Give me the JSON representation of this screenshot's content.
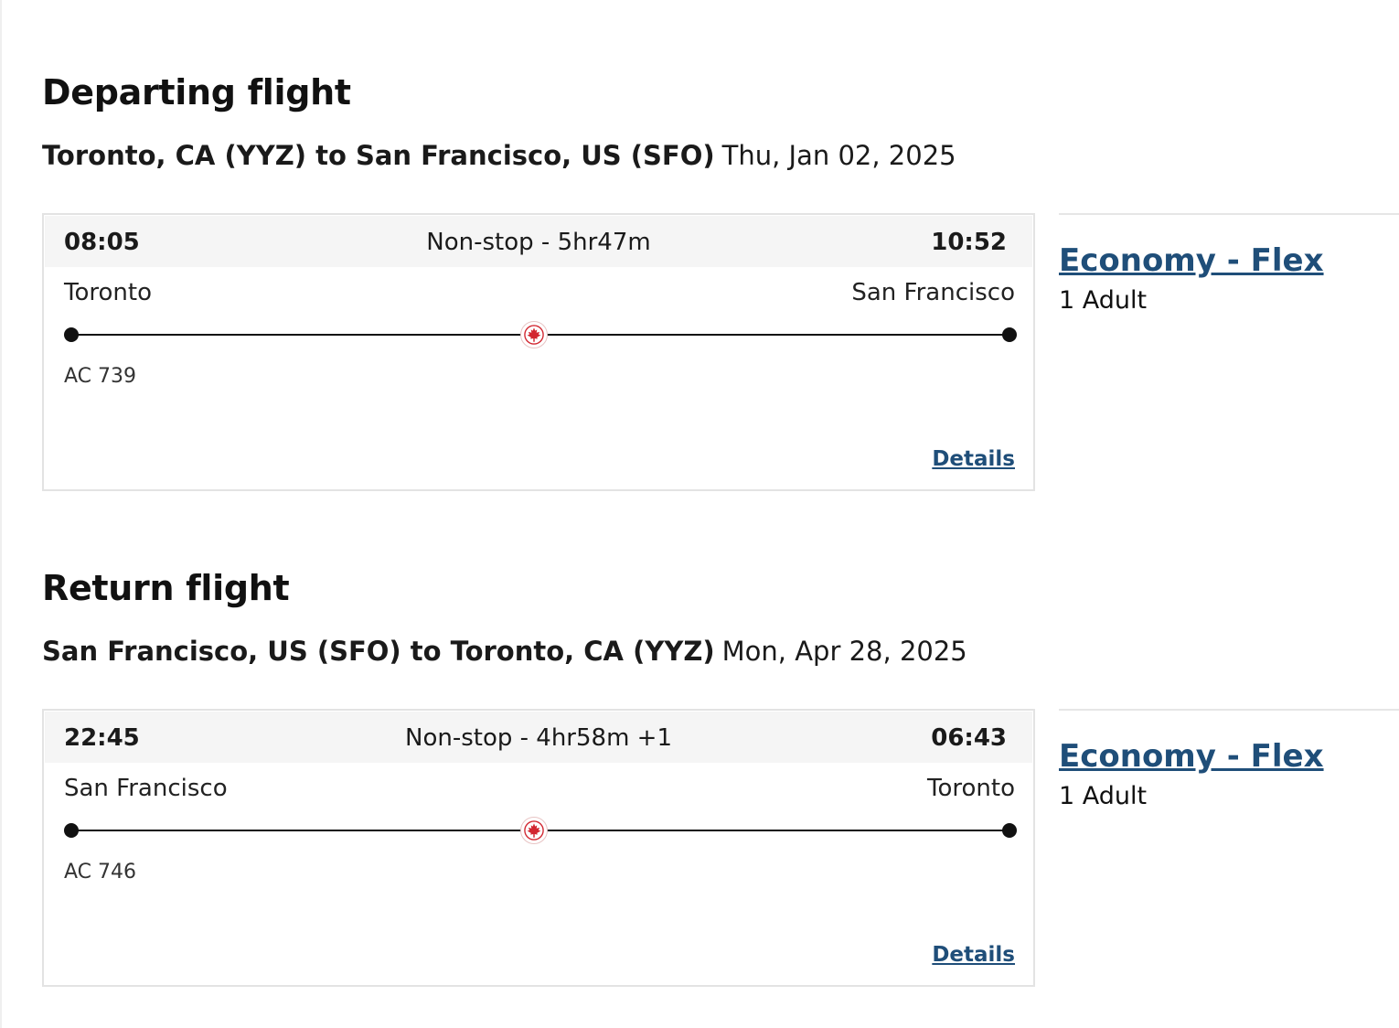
{
  "departing": {
    "title": "Departing flight",
    "route": "Toronto, CA (YYZ) to San Francisco, US (SFO)",
    "date": "Thu, Jan 02, 2025",
    "card": {
      "dep_time": "08:05",
      "duration": "Non-stop - 5hr47m",
      "arr_time": "10:52",
      "from_city": "Toronto",
      "to_city": "San Francisco",
      "flight_number": "AC 739",
      "details_label": "Details"
    },
    "fare": {
      "label": "Economy - Flex",
      "passengers": "1 Adult"
    }
  },
  "return": {
    "title": "Return flight",
    "route": "San Francisco, US (SFO) to Toronto, CA (YYZ)",
    "date": "Mon, Apr 28, 2025",
    "card": {
      "dep_time": "22:45",
      "duration": "Non-stop - 4hr58m +1",
      "arr_time": "06:43",
      "from_city": "San Francisco",
      "to_city": "Toronto",
      "flight_number": "AC 746",
      "details_label": "Details"
    },
    "fare": {
      "label": "Economy - Flex",
      "passengers": "1 Adult"
    }
  },
  "icons": {
    "airline_logo": "maple-leaf-icon"
  },
  "colors": {
    "link": "#1f4e79",
    "brand_red": "#d22630",
    "header_bg": "#f5f5f5"
  }
}
